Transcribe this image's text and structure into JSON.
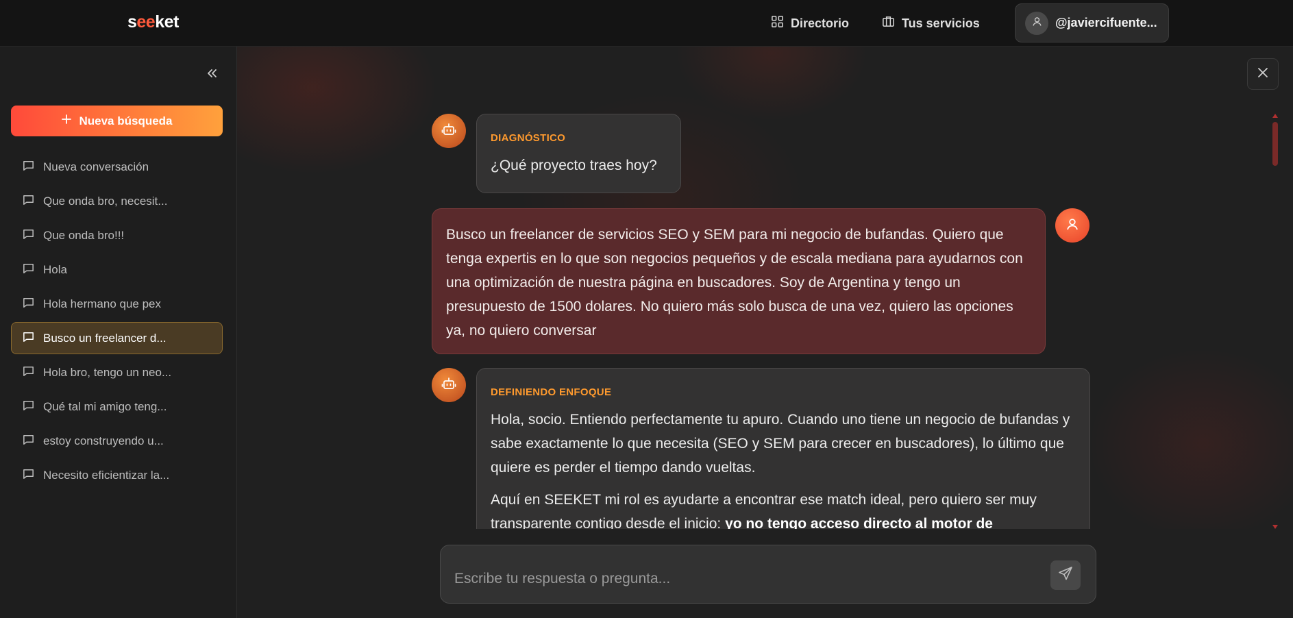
{
  "header": {
    "logo": {
      "s": "s",
      "ee": "ee",
      "ket": "ket"
    },
    "nav": {
      "directory": "Directorio",
      "services": "Tus servicios"
    },
    "user": {
      "handle": "@javiercifuente..."
    }
  },
  "sidebar": {
    "new_search_label": "Nueva búsqueda",
    "items": [
      {
        "label": "Nueva conversación"
      },
      {
        "label": "Que onda bro, necesit..."
      },
      {
        "label": "Que onda bro!!!"
      },
      {
        "label": "Hola"
      },
      {
        "label": "Hola hermano que pex"
      },
      {
        "label": "Busco un freelancer d...",
        "active": true
      },
      {
        "label": "Hola bro, tengo un neo..."
      },
      {
        "label": "Qué tal mi amigo teng..."
      },
      {
        "label": "estoy construyendo u..."
      },
      {
        "label": "Necesito eficientizar la..."
      }
    ]
  },
  "chat": {
    "messages": [
      {
        "role": "bot",
        "label": "DIAGNÓSTICO",
        "text": "¿Qué proyecto traes hoy?"
      },
      {
        "role": "user",
        "text": "Busco un freelancer de servicios SEO y SEM para mi negocio de bufandas. Quiero que tenga expertis en lo que son negocios pequeños y de escala mediana para ayudarnos con una optimización de nuestra página en buscadores. Soy de Argentina y tengo un presupuesto de 1500 dolares. No quiero más solo busca de una vez, quiero las opciones ya, no quiero conversar"
      },
      {
        "role": "bot",
        "label": "DEFINIENDO ENFOQUE",
        "para1": "Hola, socio. Entiendo perfectamente tu apuro. Cuando uno tiene un negocio de bufandas y sabe exactamente lo que necesita (SEO y SEM para crecer en buscadores), lo último que quiere es perder el tiempo dando vueltas.",
        "para2_start": "Aquí en SEEKET mi rol es ayudarte a encontrar ese match ideal, pero quiero ser muy transparente contigo desde el inicio: ",
        "para2_bold": "yo no tengo acceso directo al motor de"
      }
    ]
  },
  "input": {
    "placeholder": "Escribe tu respuesta o pregunta..."
  },
  "colors": {
    "accent_orange": "#ff9a2e",
    "accent_red": "#ff4a3a",
    "user_bubble": "#5a2a2c",
    "active_item": "#4a3b24"
  }
}
